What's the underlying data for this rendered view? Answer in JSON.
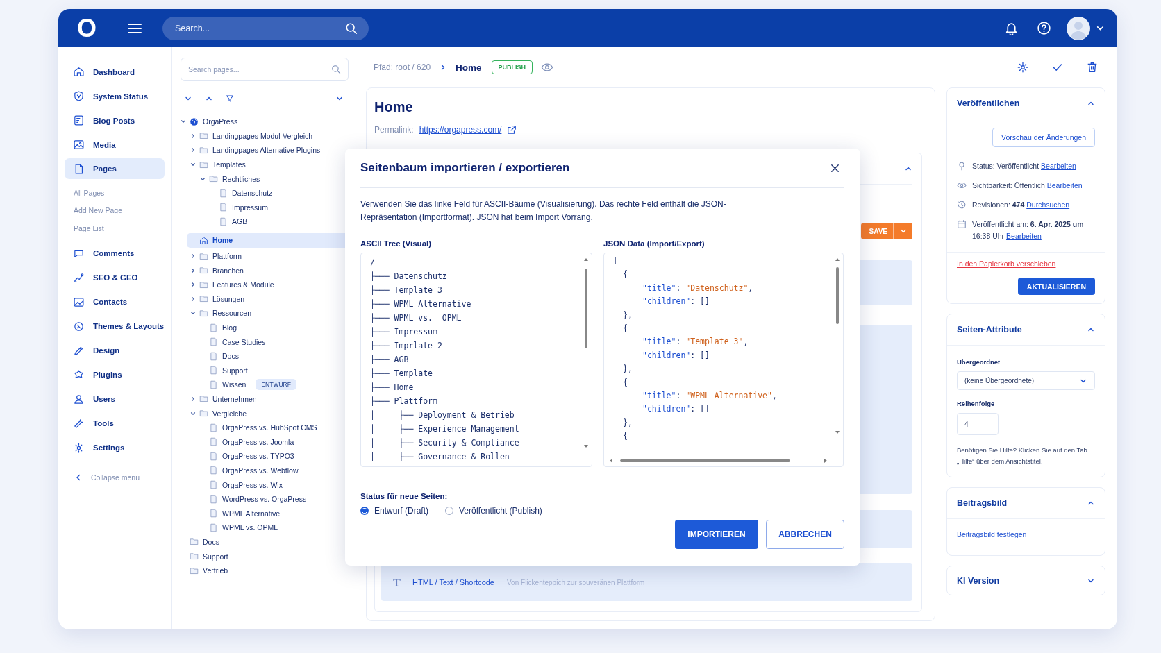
{
  "top_bar": {
    "logo": "O",
    "search_placeholder": "Search..."
  },
  "sidebar": {
    "items": [
      {
        "label": "Dashboard",
        "selected": false
      },
      {
        "label": "System Status",
        "selected": false
      },
      {
        "label": "Blog Posts",
        "selected": false
      },
      {
        "label": "Media",
        "selected": false
      },
      {
        "label": "Pages",
        "selected": true,
        "children": [
          {
            "label": "All Pages",
            "selected": false
          },
          {
            "label": "Add New Page",
            "selected": false
          },
          {
            "label": "Page List",
            "selected": false
          }
        ]
      },
      {
        "label": "Comments",
        "selected": false
      },
      {
        "label": "SEO & GEO",
        "selected": false
      },
      {
        "label": "Contacts",
        "selected": false
      },
      {
        "label": "Themes & Layouts",
        "selected": false
      },
      {
        "label": "Design",
        "selected": false
      },
      {
        "label": "Plugins",
        "selected": false
      },
      {
        "label": "Users",
        "selected": false
      },
      {
        "label": "Tools",
        "selected": false
      },
      {
        "label": "Settings",
        "selected": false
      }
    ],
    "collapse_label": "Collapse menu"
  },
  "page_tree": {
    "search_placeholder": "Search pages...",
    "nodes": [
      {
        "label": "OrgaPress",
        "kind": "site",
        "expanded": true,
        "selected": false,
        "children": [
          {
            "label": "Landingpages Modul-Vergleich",
            "kind": "folder",
            "expanded": false,
            "selected": false
          },
          {
            "label": "Landingpages Alternative Plugins",
            "kind": "folder",
            "expanded": false,
            "selected": false
          },
          {
            "label": "Templates",
            "kind": "folder",
            "expanded": true,
            "selected": false,
            "children": [
              {
                "label": "Rechtliches",
                "kind": "folder",
                "expanded": true,
                "selected": false,
                "children": [
                  {
                    "label": "Datenschutz",
                    "kind": "page",
                    "selected": false
                  },
                  {
                    "label": "Impressum",
                    "kind": "page",
                    "selected": false
                  },
                  {
                    "label": "AGB",
                    "kind": "page",
                    "selected": false
                  }
                ]
              }
            ]
          },
          {
            "label": "Home",
            "kind": "home",
            "selected": true
          },
          {
            "label": "Plattform",
            "kind": "folder",
            "expanded": false,
            "selected": false
          },
          {
            "label": "Branchen",
            "kind": "folder",
            "expanded": false,
            "selected": false
          },
          {
            "label": "Features & Module",
            "kind": "folder",
            "expanded": false,
            "selected": false
          },
          {
            "label": "Lösungen",
            "kind": "folder",
            "expanded": false,
            "selected": false
          },
          {
            "label": "Ressourcen",
            "kind": "folder",
            "expanded": true,
            "selected": false,
            "children": [
              {
                "label": "Blog",
                "kind": "page",
                "selected": false
              },
              {
                "label": "Case Studies",
                "kind": "page",
                "selected": false
              },
              {
                "label": "Docs",
                "kind": "page",
                "selected": false
              },
              {
                "label": "Support",
                "kind": "page",
                "selected": false
              },
              {
                "label": "Wissen",
                "kind": "page",
                "selected": false,
                "badge": "ENTWURF"
              }
            ]
          },
          {
            "label": "Unternehmen",
            "kind": "folder",
            "expanded": false,
            "selected": false
          },
          {
            "label": "Vergleiche",
            "kind": "folder",
            "expanded": true,
            "selected": false,
            "children": [
              {
                "label": "OrgaPress vs. HubSpot CMS",
                "kind": "page",
                "selected": false
              },
              {
                "label": "OrgaPress vs. Joomla",
                "kind": "page",
                "selected": false
              },
              {
                "label": "OrgaPress vs. TYPO3",
                "kind": "page",
                "selected": false
              },
              {
                "label": "OrgaPress vs. Webflow",
                "kind": "page",
                "selected": false
              },
              {
                "label": "OrgaPress vs. Wix",
                "kind": "page",
                "selected": false
              },
              {
                "label": "WordPress vs. OrgaPress",
                "kind": "page",
                "selected": false
              },
              {
                "label": "WPML Alternative",
                "kind": "page",
                "selected": false
              },
              {
                "label": "WPML vs. OPML",
                "kind": "page",
                "selected": false
              }
            ]
          }
        ]
      },
      {
        "label": "Docs",
        "kind": "folder",
        "selected": false
      },
      {
        "label": "Support",
        "kind": "folder",
        "selected": false
      },
      {
        "label": "Vertrieb",
        "kind": "folder",
        "selected": false
      }
    ]
  },
  "breadcrumb": {
    "path": "Pfad: root / 620",
    "current": "Home",
    "status": "PUBLISH"
  },
  "editor": {
    "title": "Home",
    "permalink_label": "Permalink:",
    "permalink": "https://orgapress.com/",
    "section_expanded": true,
    "save_label": "SAVE",
    "shortcode_block": {
      "label": "HTML / Text / Shortcode",
      "preview": "Von Flickenteppich zur souveränen Plattform"
    }
  },
  "modal": {
    "title": "Seitenbaum importieren / exportieren",
    "description": "Verwenden Sie das linke Feld für ASCII-Bäume (Visualisierung). Das rechte Feld enthält die JSON-Repräsentation (Importformat). JSON hat beim Import Vorrang.",
    "ascii_label": "ASCII Tree (Visual)",
    "ascii_lines": [
      "/",
      "├─── Datenschutz",
      "├─── Template 3",
      "├─── WPML Alternative",
      "├─── WPML vs.  OPML",
      "├─── Impressum",
      "├─── Imprlate 2",
      "├─── AGB",
      "├─── Template",
      "├─── Home",
      "├─── Plattform",
      "│     ├── Deployment & Betrieb",
      "│     ├── Experience Management",
      "│     ├── Security & Compliance",
      "│     ├── Governance & Rollen"
    ],
    "json_label": "JSON Data (Import/Export)",
    "json_lines": [
      {
        "kind": "array",
        "text": "["
      },
      {
        "kind": "object",
        "text": "{"
      },
      {
        "kind": "string_prop",
        "key": "\"title\"",
        "sep": ": ",
        "value": "\"Datenschutz\"",
        "end": ","
      },
      {
        "kind": "list_prop",
        "key": "\"children\"",
        "sep": ": ",
        "value": "[]"
      },
      {
        "kind": "object",
        "text": "},"
      },
      {
        "kind": "object",
        "text": "{"
      },
      {
        "kind": "string_prop",
        "key": "\"title\"",
        "sep": ": ",
        "value": "\"Template 3\"",
        "end": ","
      },
      {
        "kind": "list_prop",
        "key": "\"children\"",
        "sep": ": ",
        "value": "[]"
      },
      {
        "kind": "object",
        "text": "},"
      },
      {
        "kind": "object",
        "text": "{"
      },
      {
        "kind": "string_prop",
        "key": "\"title\"",
        "sep": ": ",
        "value": "\"WPML Alternative\"",
        "end": ","
      },
      {
        "kind": "list_prop",
        "key": "\"children\"",
        "sep": ": ",
        "value": "[]"
      },
      {
        "kind": "object",
        "text": "},"
      },
      {
        "kind": "object",
        "text": "{"
      }
    ],
    "status_label": "Status für neue Seiten:",
    "status_options": [
      {
        "label": "Entwurf (Draft)",
        "selected": true
      },
      {
        "label": "Veröffentlicht (Publish)",
        "selected": false
      }
    ],
    "import_label": "IMPORTIEREN",
    "cancel_label": "ABBRECHEN"
  },
  "publish_box": {
    "title": "Veröffentlichen",
    "expanded": true,
    "preview_label": "Vorschau der Änderungen",
    "rows": [
      {
        "text": "Status: Veröffentlicht",
        "link": "Bearbeiten"
      },
      {
        "text": "Sichtbarkeit: Öffentlich",
        "link": "Bearbeiten"
      },
      {
        "text": "Revisionen: **474**",
        "link": "Durchsuchen"
      },
      {
        "text": "Veröffentlicht am: **6. Apr. 2025 um** 16:38 Uhr",
        "link": "Bearbeiten"
      }
    ],
    "trash_label": "In den Papierkorb verschieben",
    "update_label": "AKTUALISIEREN"
  },
  "attributes_box": {
    "title": "Seiten-Attribute",
    "expanded": true,
    "parent_label": "Übergeordnet",
    "parent_value": "(keine Übergeordnete)",
    "order_label": "Reihenfolge",
    "order_value": "4",
    "help": "Benötigen Sie Hilfe? Klicken Sie auf den Tab „Hilfe“ über dem Ansichtstitel."
  },
  "featured_image_box": {
    "title": "Beitragsbild",
    "expanded": true,
    "link": "Beitragsbild festlegen"
  },
  "ki_version_box": {
    "title": "KI Version",
    "expanded": false
  }
}
